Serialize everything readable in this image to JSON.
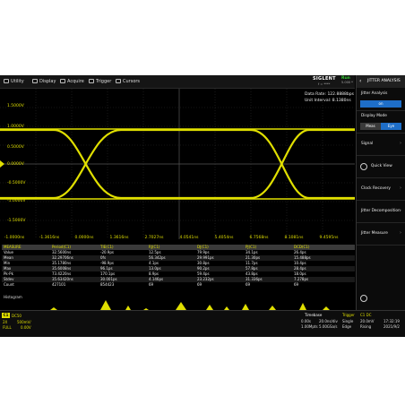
{
  "menu": {
    "items": [
      {
        "label": "Utility",
        "icon": "gear-icon"
      },
      {
        "label": "Display",
        "icon": "monitor-icon"
      },
      {
        "label": "Acquire",
        "icon": "acquire-icon"
      },
      {
        "label": "Trigger",
        "icon": "trigger-icon"
      },
      {
        "label": "Cursors",
        "icon": "cursor-icon"
      }
    ],
    "brand": "SIGLENT",
    "brand_sub": "f = ****",
    "run_status": "Run",
    "run_sub": "5.000 *"
  },
  "waveform": {
    "y_labels": [
      "1.5000V",
      "1.0000V",
      "0.5000V",
      "0.0000V",
      "-0.5000V",
      "-1.0000V",
      "-1.5000V"
    ],
    "x_labels": [
      "-1.0000ns",
      "-1.3616ns",
      "0.0000ns",
      "1.3616ns",
      "2.7027ns",
      "4.0541ns",
      "5.4054ns",
      "6.7568ns",
      "8.1081ns",
      "9.4595ns"
    ],
    "data_rate": "Data Rate: 122.8888bps",
    "unit_interval": "Unit Interval: 8.1380ns",
    "trace_color": "#e0df00"
  },
  "measure": {
    "headers": [
      "MEASURE",
      "Period(C1)",
      "TIE(C1)",
      "RJ(C1)",
      "DJ(C1)",
      "PJ(C1)",
      "DCD(C1)"
    ],
    "rows": [
      [
        "Value",
        "32.5600ns",
        "-20.9ps",
        "12.5ps",
        "79.9ps",
        "34.1ps",
        "26.4ps"
      ],
      [
        "Mean",
        "32.29706ns",
        "0fs",
        "56.342ps",
        "29.991ps",
        "21.30ps",
        "15.488ps"
      ],
      [
        "Min",
        "35.1780ns",
        "-98.9ps",
        "4.1ps",
        "30.8ps",
        "11.7ps",
        "10.4ps"
      ],
      [
        "Max",
        "35.6008ns",
        "96.1ps",
        "13.0ps",
        "90.2ps",
        "57.8ps",
        "28.4ps"
      ],
      [
        "Pk-Pk",
        "73.4220ns",
        "170.1ps",
        "8.9ps",
        "59.4ps",
        "43.8ps",
        "18.0ps"
      ],
      [
        "Stdev",
        "35.63420ns",
        "30.001ps",
        "4.146ps",
        "23.232ps",
        "31.336ps",
        "7.278ps"
      ],
      [
        "Count",
        "427101",
        "854423",
        "69",
        "69",
        "69",
        "69"
      ]
    ]
  },
  "histogram": {
    "label": "Histogram"
  },
  "bottom": {
    "ch1": "C1",
    "ch1_coupling": "DC50",
    "ch1_mode": "2X",
    "ch1_scale": "500mV/",
    "ch1_bw": "FULL",
    "ch1_offset": "0.00V",
    "timebase_title": "Timebase",
    "tb_delay": "0.00s",
    "tb_scale": "20.0ns/div",
    "tb_points": "1.00Mpts",
    "tb_rate": "5.00GSa/s",
    "trigger_title": "Trigger",
    "trig_mode": "Single",
    "trig_type": "Edge",
    "trig_ch": "C1 DC",
    "trig_level": "20.0mV",
    "trig_slope": "Rising",
    "time": "17:32:19",
    "date": "2021/9/2"
  },
  "panel": {
    "title": "JITTER ANALYSIS",
    "jitter_analysis_label": "Jitter Analysis",
    "jitter_state": "on",
    "display_mode_label": "Display Mode",
    "display_mode_options": [
      "Meas",
      "Eye"
    ],
    "signal_label": "Signal",
    "quick_view_label": "Quick View",
    "clock_recovery_label": "Clock Recovery",
    "jitter_decomp_label": "Jitter Decomposition",
    "jitter_measure_label": "Jitter Measure"
  }
}
